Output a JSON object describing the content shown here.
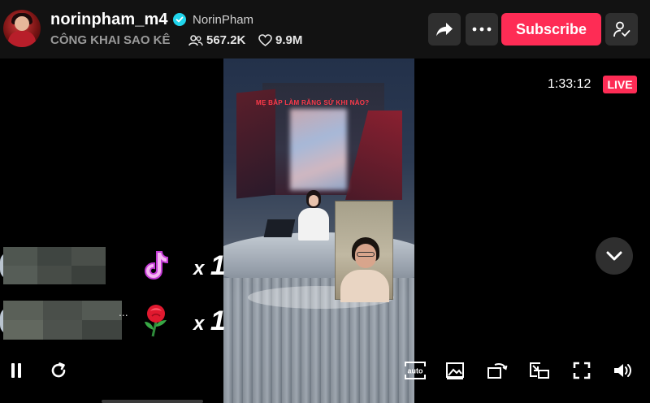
{
  "header": {
    "username": "norinpham_m4",
    "nickname": "NorinPham",
    "stream_title": "CÔNG KHAI SAO KÊ",
    "viewers": "567.2K",
    "likes": "9.9M",
    "subscribe_label": "Subscribe",
    "icons": [
      "share-icon",
      "more-icon",
      "profile-check-icon",
      "verified-icon",
      "viewers-icon",
      "heart-icon"
    ]
  },
  "stream": {
    "duration": "1:33:12",
    "live_label": "LIVE",
    "screen_caption": "MẸ BẮP LÀM RĂNG SỨ KHI NÀO?"
  },
  "gifts": [
    {
      "icon": "tiktok-music-note-gift-icon",
      "count_prefix": "x",
      "count": "1"
    },
    {
      "icon": "rose-gift-icon",
      "dots": "...",
      "count_prefix": "x",
      "count": "1"
    }
  ],
  "controls": {
    "left": [
      "pause-icon",
      "refresh-icon"
    ],
    "right": [
      "auto-quality-icon",
      "image-icon",
      "rotate-icon",
      "picture-in-picture-icon",
      "fullscreen-icon",
      "volume-icon"
    ],
    "auto_label": "auto"
  },
  "colors": {
    "accent": "#fe2c55",
    "verified": "#20d5ec",
    "header_bg": "#121212",
    "button_bg": "#2f2f2f"
  }
}
